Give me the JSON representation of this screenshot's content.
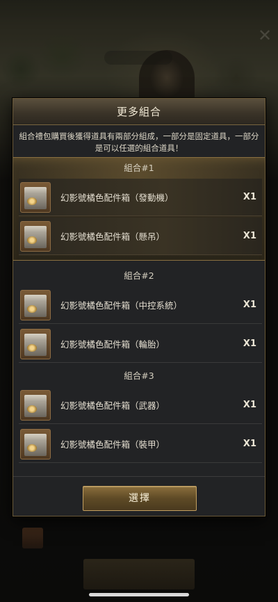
{
  "modal": {
    "title": "更多組合",
    "description": "組合禮包購買後獲得道具有兩部分組成，一部分是固定道具，一部分是可以任選的組合道具！",
    "select_label": "選擇"
  },
  "groups": [
    {
      "title": "組合#1",
      "selected": true,
      "items": [
        {
          "name": "幻影號橘色配件箱（發動機）",
          "qty": "X1",
          "icon": "crate-icon"
        },
        {
          "name": "幻影號橘色配件箱（懸吊）",
          "qty": "X1",
          "icon": "crate-icon"
        }
      ]
    },
    {
      "title": "組合#2",
      "selected": false,
      "items": [
        {
          "name": "幻影號橘色配件箱（中控系統）",
          "qty": "X1",
          "icon": "crate-icon"
        },
        {
          "name": "幻影號橘色配件箱（輪胎）",
          "qty": "X1",
          "icon": "crate-icon"
        }
      ]
    },
    {
      "title": "組合#3",
      "selected": false,
      "items": [
        {
          "name": "幻影號橘色配件箱（武器）",
          "qty": "X1",
          "icon": "crate-icon"
        },
        {
          "name": "幻影號橘色配件箱（裝甲）",
          "qty": "X1",
          "icon": "crate-icon"
        }
      ]
    }
  ],
  "colors": {
    "accent_gold": "#c4a060",
    "panel": "#222325"
  }
}
